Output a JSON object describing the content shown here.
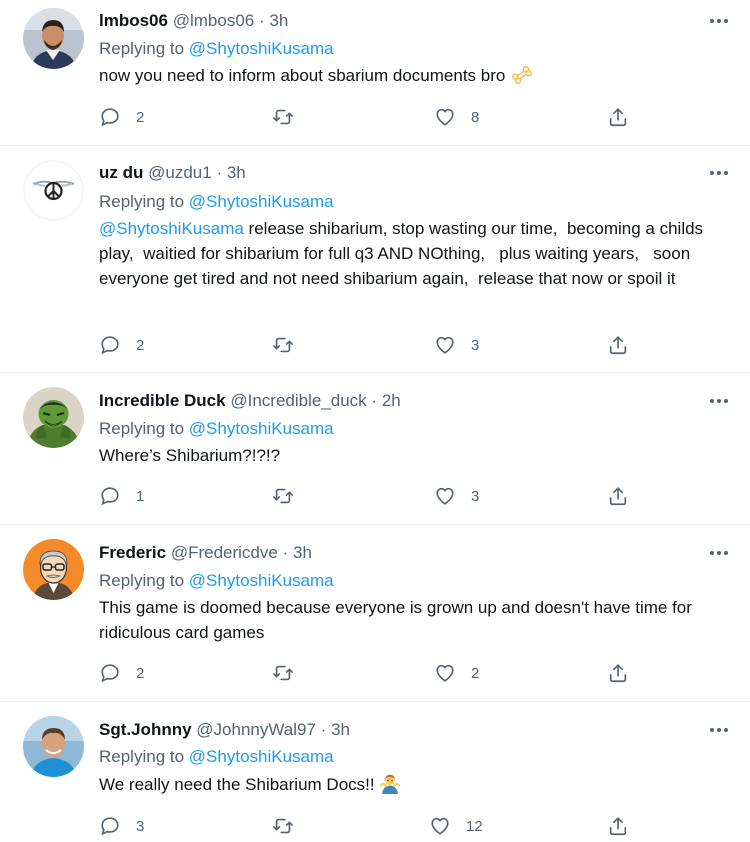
{
  "replies": [
    {
      "name": "lmbos06",
      "handle": "@lmbos06",
      "time": "3h",
      "replying_label": "Replying to",
      "replying_to": "@ShytoshiKusama",
      "mention": "",
      "text": "now you need to inform about sbarium documents bro",
      "emoji": "bone",
      "replies": "2",
      "retweets": "",
      "likes": "8"
    },
    {
      "name": "uz du",
      "handle": "@uzdu1",
      "time": "3h",
      "replying_label": "Replying to",
      "replying_to": "@ShytoshiKusama",
      "mention": "@ShytoshiKusama",
      "text": " release shibarium, stop wasting our time,  becoming a childs play,  waitied for shibarium for full q3 AND NOthing,   plus waiting years,   soon everyone get tired and not need shibarium again,  release that now or spoil it",
      "emoji": "",
      "replies": "2",
      "retweets": "",
      "likes": "3"
    },
    {
      "name": "Incredible Duck",
      "handle": "@Incredible_duck",
      "time": "2h",
      "replying_label": "Replying to",
      "replying_to": "@ShytoshiKusama",
      "mention": "",
      "text": "Where’s Shibarium?!?!?",
      "emoji": "",
      "replies": "1",
      "retweets": "",
      "likes": "3"
    },
    {
      "name": "Frederic",
      "handle": "@Fredericdve",
      "time": "3h",
      "replying_label": "Replying to",
      "replying_to": "@ShytoshiKusama",
      "mention": "",
      "text": "This game is doomed because everyone is grown up and doesn't have time for ridiculous card games",
      "emoji": "",
      "replies": "2",
      "retweets": "",
      "likes": "2"
    },
    {
      "name": "Sgt.Johnny",
      "handle": "@JohnnyWal97",
      "time": "3h",
      "replying_label": "Replying to",
      "replying_to": "@ShytoshiKusama",
      "mention": "",
      "text": "We really need the Shibarium Docs!!",
      "emoji": "man-shrugging",
      "replies": "3",
      "retweets": "",
      "likes": "12"
    }
  ],
  "dot_separator": "·",
  "icons": {
    "reply": "reply-bubble-icon",
    "retweet": "retweet-icon",
    "like": "heart-icon",
    "share": "share-icon",
    "more": "more-dots-icon"
  },
  "colors": {
    "text_primary": "#0f1419",
    "text_secondary": "#536471",
    "link": "#1d9bf0",
    "divider": "#eff3f4"
  }
}
